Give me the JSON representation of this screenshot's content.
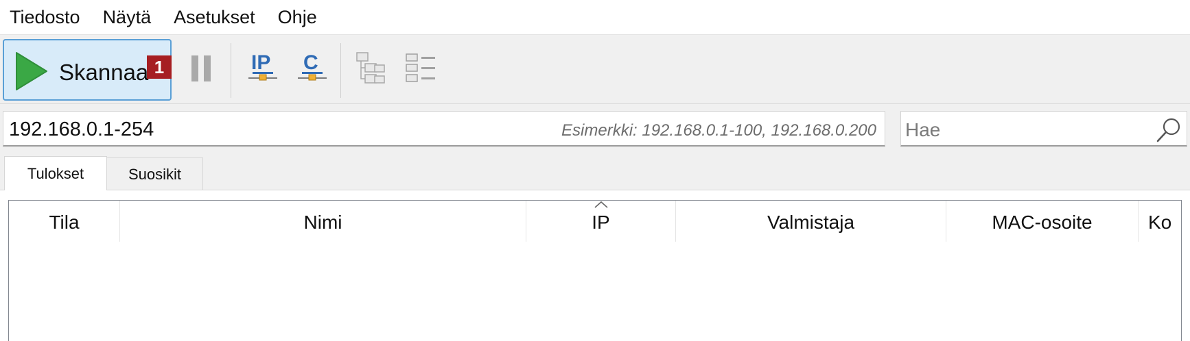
{
  "menubar": {
    "items": [
      {
        "label": "Tiedosto"
      },
      {
        "label": "Näytä"
      },
      {
        "label": "Asetukset"
      },
      {
        "label": "Ohje"
      }
    ]
  },
  "toolbar": {
    "scan_label": "Skannaa",
    "scan_badge": "1",
    "ip_icon_text": "IP",
    "c_icon_text": "C",
    "accent_color": "#5a9fd6",
    "play_color": "#3aa845"
  },
  "address": {
    "range_value": "192.168.0.1-254",
    "range_hint": "Esimerkki: 192.168.0.1-100, 192.168.0.200",
    "search_placeholder": "Hae"
  },
  "tabs": [
    {
      "label": "Tulokset",
      "active": true
    },
    {
      "label": "Suosikit",
      "active": false
    }
  ],
  "table": {
    "columns": [
      {
        "label": "Tila"
      },
      {
        "label": "Nimi"
      },
      {
        "label": "IP",
        "sorted": "ascending"
      },
      {
        "label": "Valmistaja"
      },
      {
        "label": "MAC-osoite"
      },
      {
        "label": "Ko"
      }
    ],
    "rows": []
  }
}
